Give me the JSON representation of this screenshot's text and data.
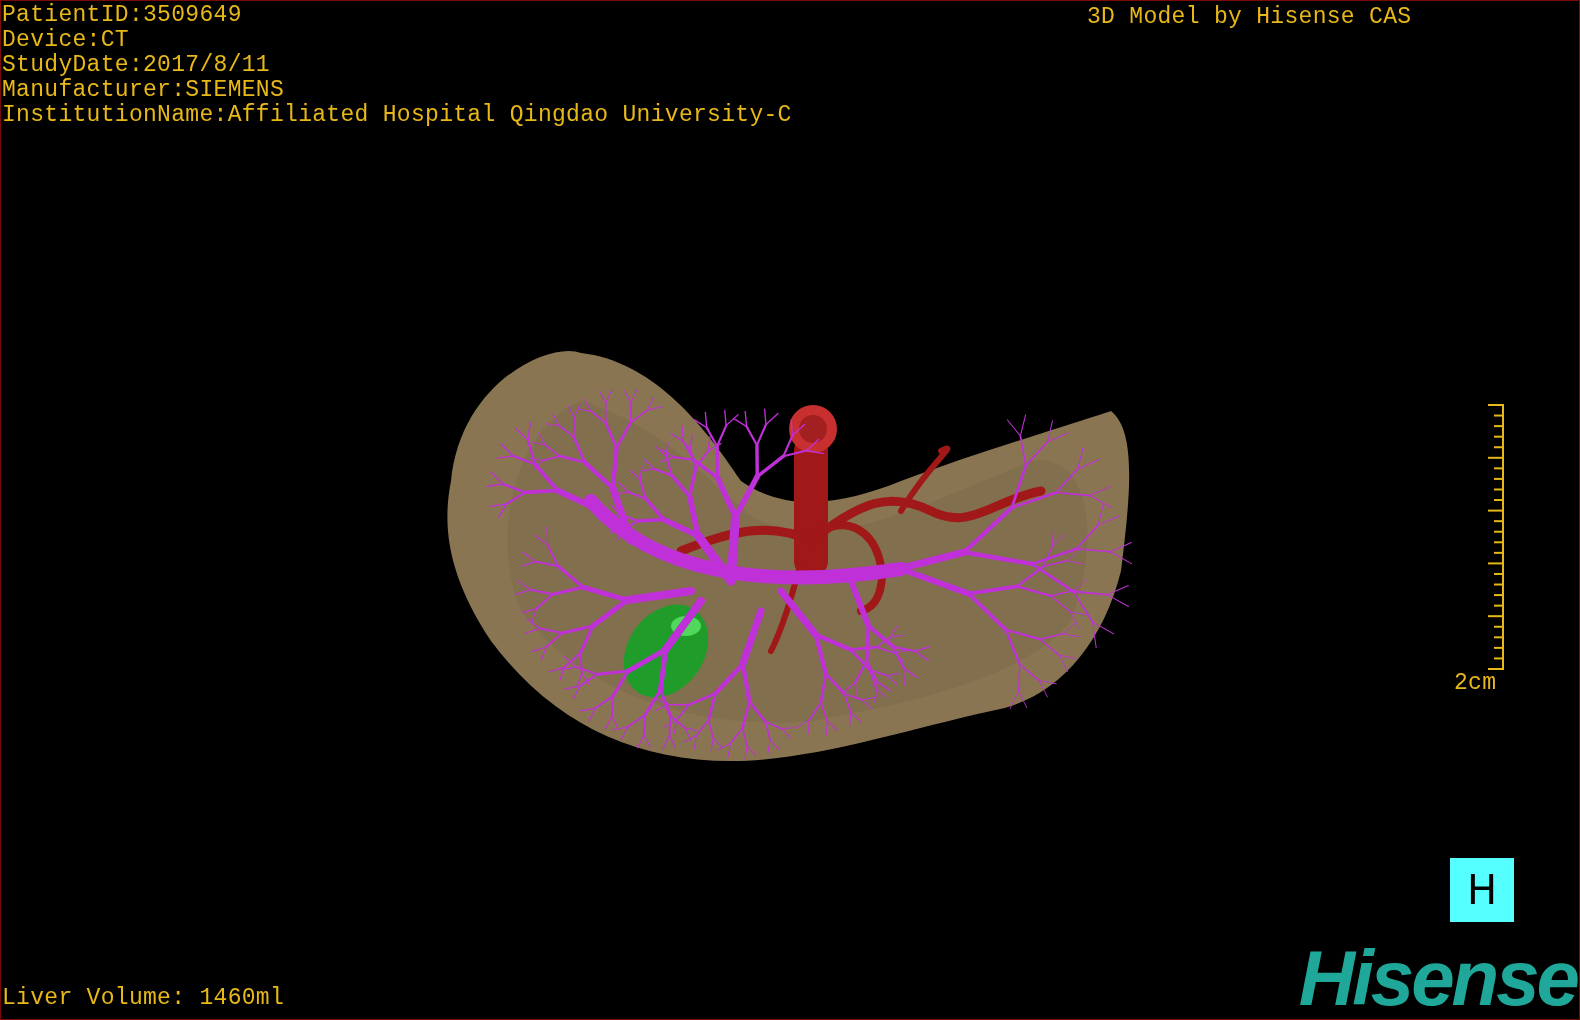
{
  "info_lines": [
    "PatientID:3509649",
    "Device:CT",
    "StudyDate:2017/8/11",
    "Manufacturer:SIEMENS",
    "InstitutionName:Affiliated Hospital Qingdao University-C"
  ],
  "title": "3D Model by Hisense CAS",
  "scale_label": "2cm",
  "view_button": "H",
  "volume": "Liver Volume: 1460ml",
  "logo": "Hisense"
}
